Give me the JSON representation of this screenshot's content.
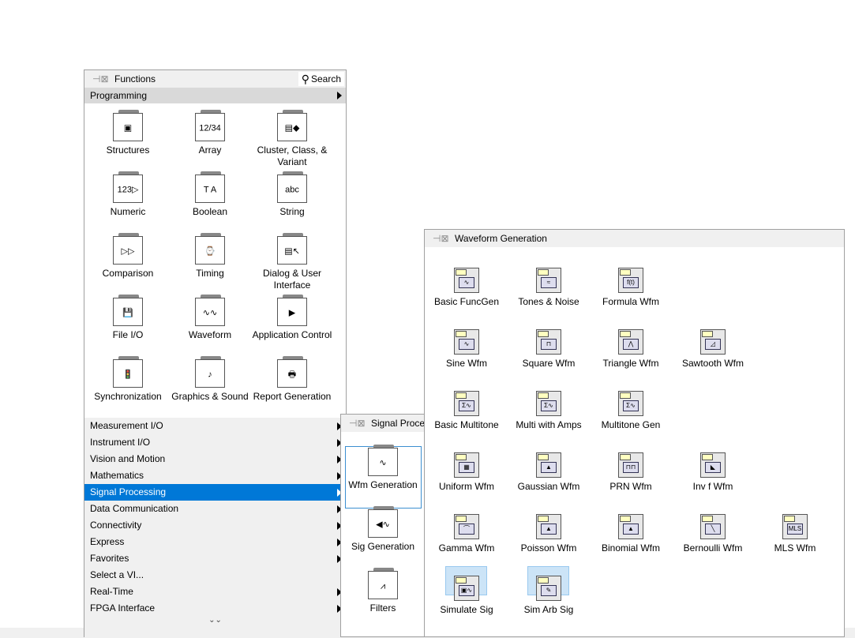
{
  "functions_palette": {
    "title": "Functions",
    "search_label": "Search",
    "category": "Programming",
    "icons": [
      {
        "label": "Structures",
        "glyph": "▣"
      },
      {
        "label": "Array",
        "glyph": "12/34"
      },
      {
        "label": "Cluster, Class, & Variant",
        "glyph": "▤◆"
      },
      {
        "label": "Numeric",
        "glyph": "123▷"
      },
      {
        "label": "Boolean",
        "glyph": "T A"
      },
      {
        "label": "String",
        "glyph": "abc"
      },
      {
        "label": "Comparison",
        "glyph": "▷▷"
      },
      {
        "label": "Timing",
        "glyph": "⌚"
      },
      {
        "label": "Dialog & User Interface",
        "glyph": "▤↖"
      },
      {
        "label": "File I/O",
        "glyph": "💾"
      },
      {
        "label": "Waveform",
        "glyph": "∿∿"
      },
      {
        "label": "Application Control",
        "glyph": "▶"
      },
      {
        "label": "Synchronization",
        "glyph": "🚦"
      },
      {
        "label": "Graphics & Sound",
        "glyph": "♪"
      },
      {
        "label": "Report Generation",
        "glyph": "🖶"
      }
    ],
    "menu": [
      {
        "label": "Measurement I/O",
        "arrow": true
      },
      {
        "label": "Instrument I/O",
        "arrow": true
      },
      {
        "label": "Vision and Motion",
        "arrow": true
      },
      {
        "label": "Mathematics",
        "arrow": true
      },
      {
        "label": "Signal Processing",
        "arrow": true,
        "selected": true
      },
      {
        "label": "Data Communication",
        "arrow": true
      },
      {
        "label": "Connectivity",
        "arrow": true
      },
      {
        "label": "Express",
        "arrow": true
      },
      {
        "label": "Favorites",
        "arrow": true
      },
      {
        "label": "Select a VI...",
        "arrow": false
      },
      {
        "label": "Real-Time",
        "arrow": true
      },
      {
        "label": "FPGA Interface",
        "arrow": true
      }
    ],
    "more_icon": "chevron-double-down-icon"
  },
  "signal_palette": {
    "title": "Signal Proce",
    "icons": [
      {
        "label": "Wfm Generation",
        "glyph": "∿",
        "selected": true
      },
      {
        "label": "Sig Generation",
        "glyph": "◀∿"
      },
      {
        "label": "Filters",
        "glyph": "⩘"
      }
    ]
  },
  "waveform_palette": {
    "title": "Waveform Generation",
    "rows": [
      [
        {
          "label": "Basic FuncGen",
          "glyph": "∿"
        },
        {
          "label": "Tones & Noise",
          "glyph": "≈"
        },
        {
          "label": "Formula Wfm",
          "glyph": "f(t)"
        }
      ],
      [
        {
          "label": "Sine Wfm",
          "glyph": "∿"
        },
        {
          "label": "Square Wfm",
          "glyph": "⊓"
        },
        {
          "label": "Triangle Wfm",
          "glyph": "⋀"
        },
        {
          "label": "Sawtooth Wfm",
          "glyph": "◿"
        }
      ],
      [
        {
          "label": "Basic Multitone",
          "glyph": "Σ∿"
        },
        {
          "label": "Multi with Amps",
          "glyph": "Σ∿"
        },
        {
          "label": "Multitone Gen",
          "glyph": "Σ∿"
        }
      ],
      [
        {
          "label": "Uniform Wfm",
          "glyph": "▦"
        },
        {
          "label": "Gaussian Wfm",
          "glyph": "▲"
        },
        {
          "label": "PRN Wfm",
          "glyph": "⊓⊓"
        },
        {
          "label": "Inv f Wfm",
          "glyph": "◣"
        }
      ],
      [
        {
          "label": "Gamma Wfm",
          "glyph": "⌒"
        },
        {
          "label": "Poisson Wfm",
          "glyph": "▲"
        },
        {
          "label": "Binomial Wfm",
          "glyph": "▲"
        },
        {
          "label": "Bernoulli Wfm",
          "glyph": "╲"
        },
        {
          "label": "MLS Wfm",
          "glyph": "MLS"
        }
      ],
      [
        {
          "label": "Simulate Sig",
          "glyph": "▣∿",
          "selected": true
        },
        {
          "label": "Sim Arb Sig",
          "glyph": "✎",
          "selected": true
        }
      ]
    ]
  }
}
